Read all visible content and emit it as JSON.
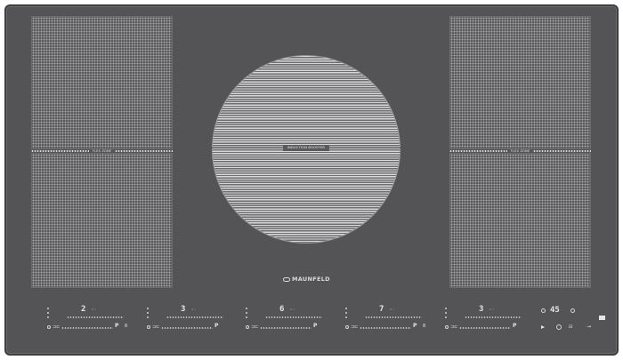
{
  "zones": {
    "left_divider_label": "FLEX ZONE",
    "right_divider_label": "FLEX ZONE",
    "center_label": "INDUCTION BOOSTER"
  },
  "brand": {
    "name": "MAUNFELD"
  },
  "controls": [
    {
      "level": "2",
      "boost": "8"
    },
    {
      "level": "3",
      "boost": ""
    },
    {
      "level": "6",
      "boost": ""
    },
    {
      "level": "7",
      "boost": "8"
    },
    {
      "level": "3",
      "boost": ""
    }
  ],
  "timer": {
    "value": "45"
  },
  "colors": {
    "glass": "#545456",
    "zone_dots": "#a9a9ab",
    "text": "#e4e4e4"
  }
}
